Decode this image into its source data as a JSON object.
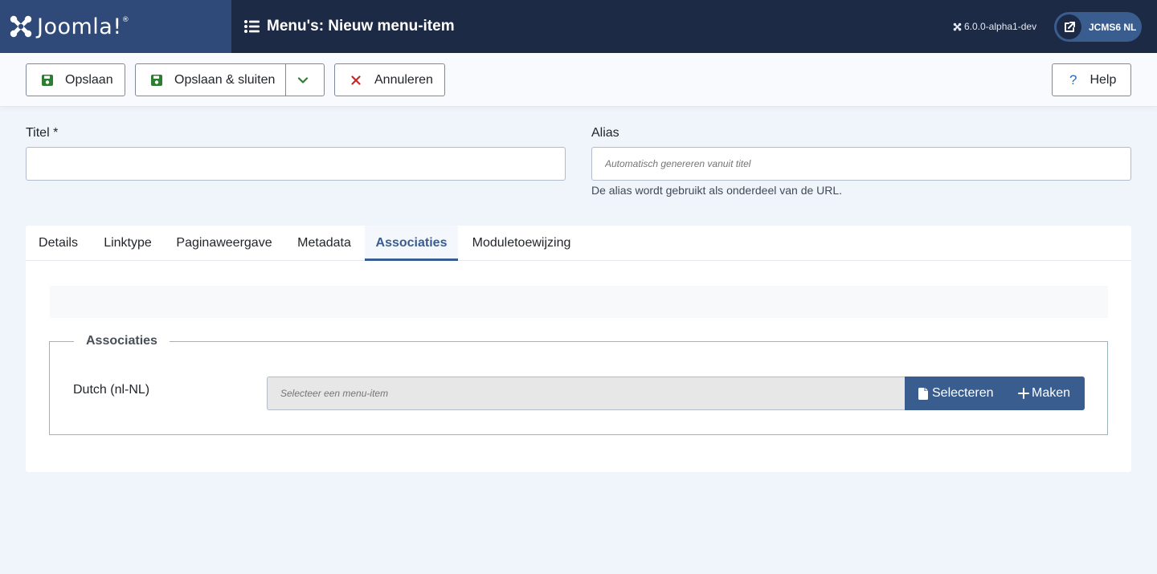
{
  "header": {
    "logo_text": "Joomla!",
    "page_title": "Menu's: Nieuw menu-item",
    "version": "6.0.0-alpha1-dev",
    "site_button": "JCMS6 NL"
  },
  "toolbar": {
    "save_label": "Opslaan",
    "save_close_label": "Opslaan & sluiten",
    "cancel_label": "Annuleren",
    "help_label": "Help"
  },
  "form": {
    "title_label": "Titel *",
    "title_value": "",
    "alias_label": "Alias",
    "alias_placeholder": "Automatisch genereren vanuit titel",
    "alias_hint": "De alias wordt gebruikt als onderdeel van de URL."
  },
  "tabs": [
    {
      "label": "Details"
    },
    {
      "label": "Linktype"
    },
    {
      "label": "Paginaweergave"
    },
    {
      "label": "Metadata"
    },
    {
      "label": "Associaties"
    },
    {
      "label": "Moduletoewijzing"
    }
  ],
  "active_tab": "Associaties",
  "associations": {
    "legend": "Associaties",
    "language_label": "Dutch (nl-NL)",
    "input_placeholder": "Selecteer een menu-item",
    "select_label": "Selecteren",
    "create_label": "Maken"
  },
  "colors": {
    "header_bg": "#1c2a46",
    "logo_bg": "#2f4a78",
    "accent": "#3a5d8f",
    "save_icon": "#2f7d32",
    "cancel_icon": "#c52827",
    "page_bg": "#f0f4fb"
  }
}
